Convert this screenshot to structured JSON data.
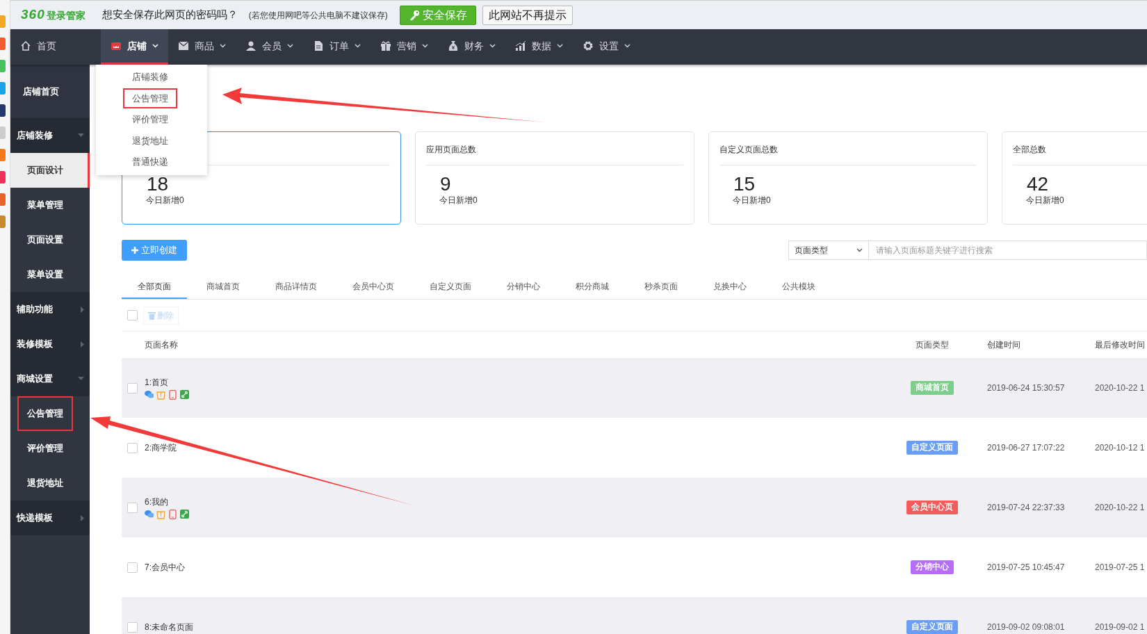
{
  "prompt_bar": {
    "logo_number": "360",
    "logo_text": "登录管家",
    "question": "想安全保存此网页的密码吗？",
    "hint": "(若您使用网吧等公共电脑不建议保存)",
    "save_button": "安全保存",
    "dismiss_button": "此网站不再提示"
  },
  "nav": {
    "home": "首页",
    "items": [
      {
        "label": "店铺",
        "selected": true
      },
      {
        "label": "商品",
        "selected": false
      },
      {
        "label": "会员",
        "selected": false
      },
      {
        "label": "订单",
        "selected": false
      },
      {
        "label": "营销",
        "selected": false
      },
      {
        "label": "财务",
        "selected": false
      },
      {
        "label": "数据",
        "selected": false
      },
      {
        "label": "设置",
        "selected": false
      }
    ]
  },
  "nav_dropdown": {
    "items": [
      {
        "label": "店铺装修",
        "highlighted": false
      },
      {
        "label": "公告管理",
        "highlighted": true
      },
      {
        "label": "评价管理",
        "highlighted": false
      },
      {
        "label": "退货地址",
        "highlighted": false
      },
      {
        "label": "普通快递",
        "highlighted": false
      }
    ]
  },
  "sidebar": {
    "items": [
      {
        "label": "店铺首页",
        "kind": "link"
      },
      {
        "label": "店铺装修",
        "kind": "group",
        "expanded": true,
        "children": [
          {
            "label": "页面设计",
            "selected": true,
            "highlighted": false
          },
          {
            "label": "菜单管理",
            "selected": false,
            "highlighted": false
          },
          {
            "label": "页面设置",
            "selected": false,
            "highlighted": false
          },
          {
            "label": "菜单设置",
            "selected": false,
            "highlighted": false
          }
        ]
      },
      {
        "label": "辅助功能",
        "kind": "group",
        "expanded": false
      },
      {
        "label": "装修模板",
        "kind": "group",
        "expanded": false
      },
      {
        "label": "商城设置",
        "kind": "group",
        "expanded": true,
        "children": [
          {
            "label": "公告管理",
            "selected": false,
            "highlighted": true
          },
          {
            "label": "评价管理",
            "selected": false,
            "highlighted": false
          },
          {
            "label": "退货地址",
            "selected": false,
            "highlighted": false
          }
        ]
      },
      {
        "label": "快递模板",
        "kind": "group",
        "expanded": false
      }
    ]
  },
  "stats": [
    {
      "value": "18",
      "today": "今日新增0",
      "selected": true
    },
    {
      "title": "应用页面总数",
      "value": "9",
      "today": "今日新增0",
      "selected": false
    },
    {
      "title": "自定义页面总数",
      "value": "15",
      "today": "今日新增0",
      "selected": false
    },
    {
      "title": "全部总数",
      "value": "42",
      "today": "今日新增0",
      "selected": false
    }
  ],
  "toolbar": {
    "create_button": "立即创建",
    "type_select": "页面类型",
    "search_placeholder": "请输入页面标题关键字进行搜索"
  },
  "tabs": [
    {
      "label": "全部页面",
      "selected": true
    },
    {
      "label": "商城首页",
      "selected": false
    },
    {
      "label": "商品详情页",
      "selected": false
    },
    {
      "label": "会员中心页",
      "selected": false
    },
    {
      "label": "自定义页面",
      "selected": false
    },
    {
      "label": "分销中心",
      "selected": false
    },
    {
      "label": "积分商城",
      "selected": false
    },
    {
      "label": "秒杀页面",
      "selected": false
    },
    {
      "label": "兑换中心",
      "selected": false
    },
    {
      "label": "公共模块",
      "selected": false
    }
  ],
  "select_all": {
    "checked": false
  },
  "delete_button": {
    "label": "删除",
    "disabled": true
  },
  "table": {
    "columns": [
      "页面名称",
      "页面类型",
      "创建时间",
      "最后修改时间"
    ],
    "rows": [
      {
        "name": "1:首页",
        "checked": false,
        "show_channel_icons": true,
        "type": "商城首页",
        "color": "#7ccf8a",
        "created": "2019-06-24 15:30:57",
        "modified": "2020-10-22 1"
      },
      {
        "name": "2:商学院",
        "checked": false,
        "show_channel_icons": false,
        "type": "自定义页面",
        "color": "#6a9ef5",
        "created": "2019-06-27 17:07:22",
        "modified": "2020-10-12 1"
      },
      {
        "name": "6:我的",
        "checked": false,
        "show_channel_icons": true,
        "type": "会员中心页",
        "color": "#f45c5c",
        "created": "2019-07-24 22:37:33",
        "modified": "2020-10-22 1"
      },
      {
        "name": "7:会员中心",
        "checked": false,
        "show_channel_icons": false,
        "type": "分销中心",
        "color": "#b56ef5",
        "created": "2019-07-25 10:45:47",
        "modified": "2019-07-25 1"
      },
      {
        "name": "8:未命名页面",
        "checked": false,
        "show_channel_icons": false,
        "type": "自定义页面",
        "color": "#6a9ef5",
        "created": "2019-09-02 09:08:01",
        "modified": "2019-09-02 1"
      }
    ]
  }
}
